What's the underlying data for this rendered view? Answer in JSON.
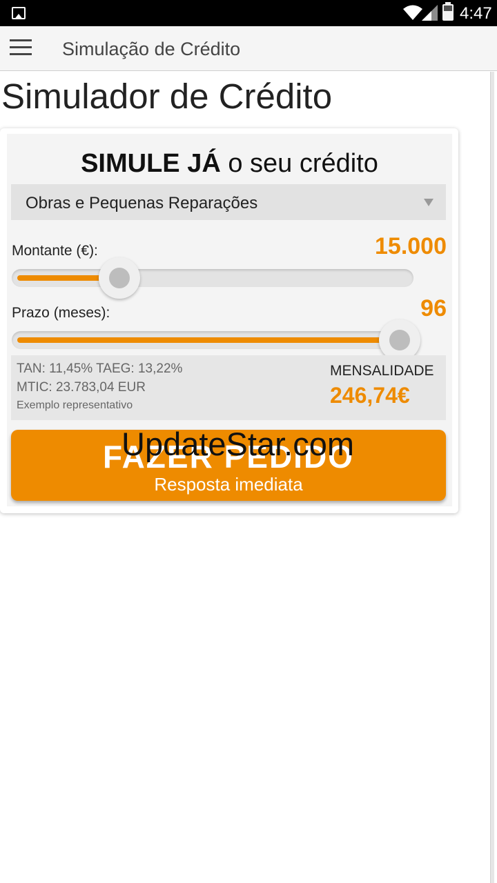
{
  "status_bar": {
    "time": "4:47",
    "icons": [
      "gallery-icon",
      "wifi-icon",
      "signal-icon",
      "battery-icon"
    ]
  },
  "action_bar": {
    "title": "Simulação de Crédito",
    "menu_icon": "hamburger-menu-icon"
  },
  "page": {
    "heading": "Simulador de Crédito"
  },
  "simulator": {
    "headline_bold": "SIMULE JÁ",
    "headline_rest": " o seu crédito",
    "credit_type": "Obras e Pequenas Reparações",
    "amount": {
      "label": "Montante (€):",
      "value": "15.000",
      "slider_fraction": 0.25
    },
    "term": {
      "label": "Prazo (meses):",
      "value": "96",
      "slider_fraction": 1.0
    },
    "summary": {
      "rates": "TAN: 11,45% TAEG: 13,22%",
      "mtic": "MTIC: 23.783,04 EUR",
      "example": "Exemplo representativo",
      "monthly_label": "MENSALIDADE",
      "monthly_value": "246,74€"
    },
    "cta": {
      "main": "FAZER PEDIDO",
      "sub": "Resposta imediata"
    }
  },
  "watermark": "UpdateStar.com",
  "colors": {
    "accent": "#ee8b00",
    "status_bar": "#000000",
    "action_bar": "#f5f5f5"
  }
}
